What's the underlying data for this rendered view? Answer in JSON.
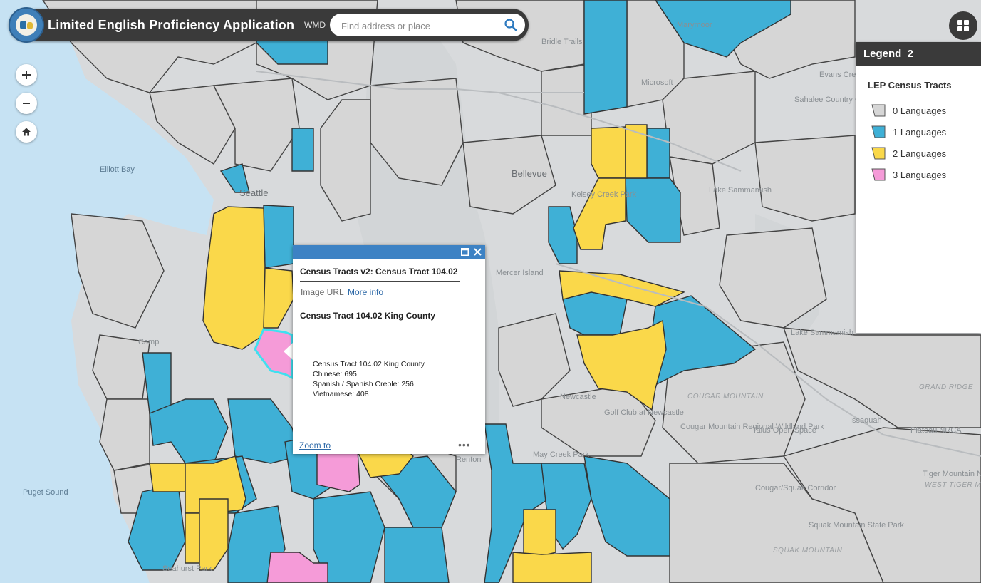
{
  "header": {
    "title": "Limited English Proficiency Application",
    "subtitle": "WMD",
    "search_placeholder": "Find address or place"
  },
  "icons": {
    "logo": "wmd-logo-icon",
    "search": "search-icon",
    "zoom_in": "plus-icon",
    "zoom_out": "minus-icon",
    "home": "home-icon",
    "app_grid": "grid-icon",
    "maximize": "maximize-icon",
    "close": "close-icon"
  },
  "zoom": {
    "in_label": "+",
    "out_label": "−"
  },
  "legend": {
    "title": "Legend_2",
    "layer": "LEP Census Tracts",
    "items": [
      {
        "label": "0 Languages",
        "color": "#d6d6d6"
      },
      {
        "label": "1 Languages",
        "color": "#3fb0d6"
      },
      {
        "label": "2 Languages",
        "color": "#fad84a"
      },
      {
        "label": "3 Languages",
        "color": "#f59bd8"
      }
    ]
  },
  "popup": {
    "title": "Census Tracts v2: Census Tract 104.02",
    "image_url_label": "Image URL",
    "more_info": "More info",
    "heading": "Census Tract 104.02 King County",
    "detail_title": "Census Tract 104.02 King County",
    "details": [
      "Chinese: 695",
      "Spanish / Spanish Creole: 256",
      "Vietnamese: 408"
    ],
    "zoom_to": "Zoom to",
    "more_actions": "•••"
  },
  "map_labels": {
    "water": [
      "Elliott Bay",
      "Puget Sound"
    ],
    "cities": [
      "Seattle",
      "Bellevue",
      "Newcastle",
      "Issaquah"
    ],
    "places": [
      "Marymoor",
      "Bridle Trails State Park",
      "Microsoft",
      "Evans Creek Preserve",
      "Sahalee Country Club",
      "Kelsey Creek Park",
      "Lake Sammamish",
      "Lake Sammamish State Park",
      "Mercer Island",
      "Camp",
      "Cougar Mountain Regional Wildland Park",
      "Golf Club at Newcastle",
      "Talus Open Space",
      "Tiger Mountain NRCA",
      "Cougar/Squak Corridor",
      "Squak Mountain State Park",
      "Plateau NRCA",
      "Seahurst Park",
      "May Creek Park",
      "Renton"
    ],
    "italic": [
      "COUGAR MOUNTAIN",
      "GRAND RIDGE",
      "WEST TIGER MOUNTAIN",
      "SQUAK MOUNTAIN"
    ]
  },
  "colors": {
    "zero": "#d6d6d6",
    "one": "#3fb0d6",
    "two": "#fad84a",
    "three": "#f59bd8",
    "water": "#c6e2f3",
    "header": "#3a3a3a",
    "popup_bar": "#3d82c4"
  }
}
